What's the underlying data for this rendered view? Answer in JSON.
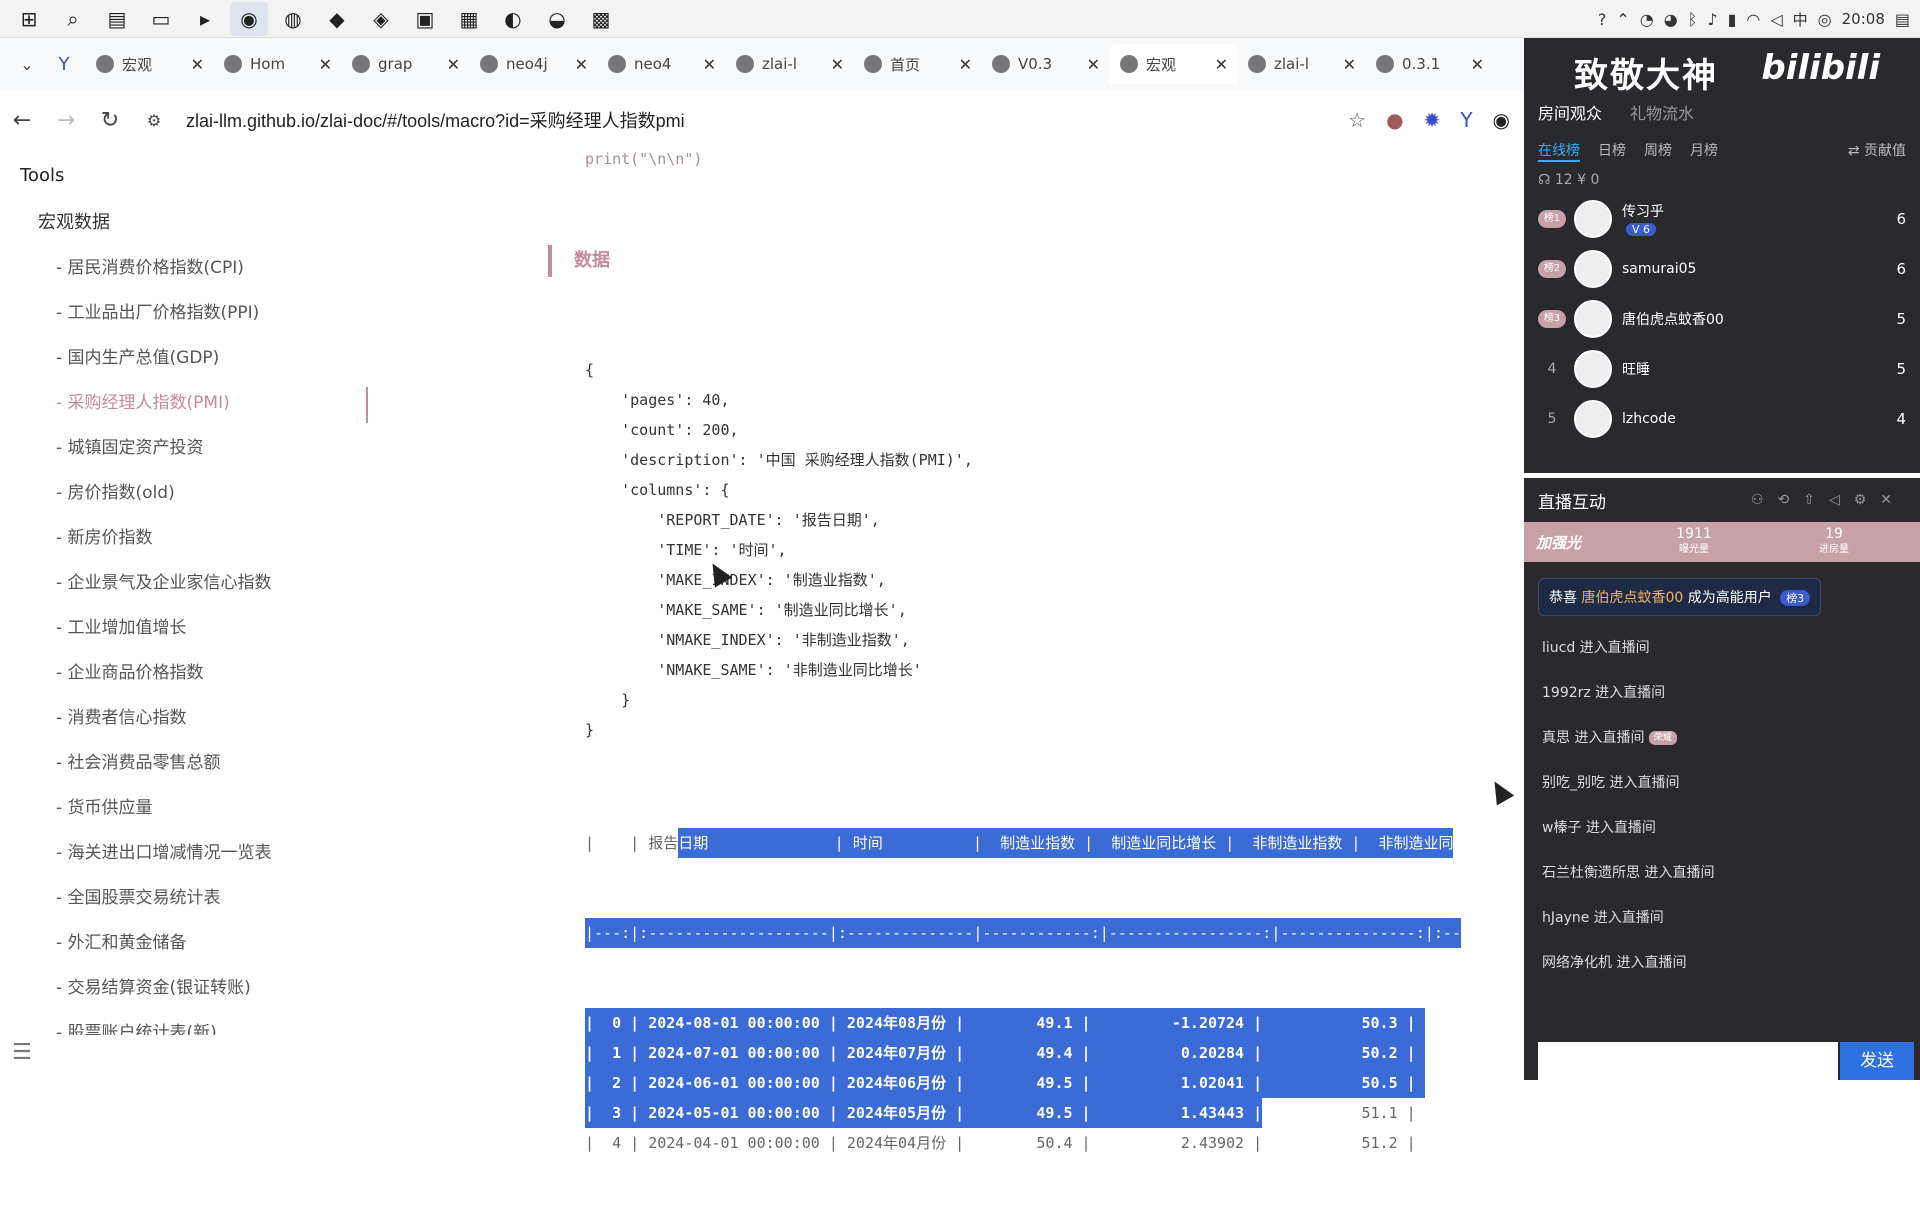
{
  "taskbar": {
    "time": "20:08",
    "ime": "中",
    "apps": [
      "start-icon",
      "search-icon",
      "taskview-icon",
      "explorer-icon",
      "terminal-icon",
      "chrome-icon",
      "wechat-icon",
      "app-icon",
      "app-icon",
      "app-icon",
      "app-icon",
      "app-icon",
      "app-icon",
      "app-icon"
    ]
  },
  "tabs": [
    {
      "title": "宏观",
      "active": false
    },
    {
      "title": "Hom",
      "active": false
    },
    {
      "title": "grap",
      "active": false
    },
    {
      "title": "neo4j",
      "active": false
    },
    {
      "title": "neo4",
      "active": false
    },
    {
      "title": "zlai-l",
      "active": false
    },
    {
      "title": "首页",
      "active": false
    },
    {
      "title": "V0.3",
      "active": false
    },
    {
      "title": "宏观",
      "active": true
    },
    {
      "title": "zlai-l",
      "active": false
    },
    {
      "title": "0.3.1",
      "active": false
    }
  ],
  "address": {
    "url": "zlai-llm.github.io/zlai-doc/#/tools/macro?id=采购经理人指数pmi"
  },
  "sidebar": {
    "title": "Tools",
    "group": "宏观数据",
    "items": [
      "- 居民消费价格指数(CPI)",
      "- 工业品出厂价格指数(PPI)",
      "- 国内生产总值(GDP)",
      "- 采购经理人指数(PMI)",
      "- 城镇固定资产投资",
      "- 房价指数(old)",
      "- 新房价指数",
      "- 企业景气及企业家信心指数",
      "- 工业增加值增长",
      "- 企业商品价格指数",
      "- 消费者信心指数",
      "- 社会消费品零售总额",
      "- 货币供应量",
      "- 海关进出口增减情况一览表",
      "- 全国股票交易统计表",
      "- 外汇和黄金储备",
      "- 交易结算资金(银证转账)",
      "- 股票账户统计表(新)"
    ],
    "active_index": 3
  },
  "content": {
    "code_top": "print(\"\\n\\n\")",
    "section": "数据",
    "json_lines": [
      "{",
      "    'pages': 40,",
      "    'count': 200,",
      "    'description': '中国 采购经理人指数(PMI)',",
      "    'columns': {",
      "        'REPORT_DATE': '报告日期',",
      "        'TIME': '时间',",
      "        'MAKE_INDEX': '制造业指数',",
      "        'MAKE_SAME': '制造业同比增长',",
      "        'NMAKE_INDEX': '非制造业指数',",
      "        'NMAKE_SAME': '非制造业同比增长'",
      "    }",
      "}"
    ],
    "table": {
      "header_pre": "|    | 报告",
      "header_hl": "日期              | 时间          |  制造业指数 |  制造业同比增长 |  非制造业指数 |  非制造业同",
      "sep": "|---:|:--------------------|:--------------|------------:|-----------------:|---------------:|:--",
      "rows": [
        {
          "hl": "|  0 | 2024-08-01 00:00:00 | 2024年08月份 |        49.1 |         -1.20724 |           50.3 | ",
          "plain": ""
        },
        {
          "hl": "|  1 | 2024-07-01 00:00:00 | 2024年07月份 |        49.4 |          0.20284 |           50.2 | ",
          "plain": ""
        },
        {
          "hl": "|  2 | 2024-06-01 00:00:00 | 2024年06月份 |        49.5 |          1.02041 |           50.5 | ",
          "plain": ""
        },
        {
          "hl": "|  3 | 2024-05-01 00:00:00 | 2024年05月份 |        49.5 |          1.43443 |",
          "plain": "           51.1 |"
        },
        {
          "hl": "",
          "plain": "|  4 | 2024-04-01 00:00:00 | 2024年04月份 |        50.4 |          2.43902 |           51.2 |"
        }
      ]
    }
  },
  "bili_top": {
    "banner": "致敬大神",
    "brand": "bilibili",
    "tabs1": [
      "房间观众",
      "礼物流水"
    ],
    "tabs2": [
      "在线榜",
      "日榜",
      "周榜",
      "月榜"
    ],
    "contrib": "⇄ 贡献值",
    "stats": "☊ 12  ¥ 0",
    "ranks": [
      {
        "badge": "榜1",
        "name": "传习乎",
        "fan": "6",
        "score": "6"
      },
      {
        "badge": "榜2",
        "name": "samurai05",
        "fan": "",
        "score": "6"
      },
      {
        "badge": "榜3",
        "name": "唐伯虎点蚊香00",
        "fan": "",
        "score": "5"
      },
      {
        "badge": "4",
        "name": "旺睡",
        "fan": "",
        "score": "5"
      },
      {
        "badge": "5",
        "name": "lzhcode",
        "fan": "",
        "score": "4"
      }
    ]
  },
  "bili_bottom": {
    "title": "直播互动",
    "strip_label": "加强光",
    "stat1_value": "1911",
    "stat1_label": "曝光量",
    "stat2_value": "19",
    "stat2_label": "进房量",
    "congrats_prefix": "恭喜 ",
    "congrats_name": "唐伯虎点蚊香00",
    "congrats_suffix": " 成为高能用户",
    "congrats_tag": "榜3",
    "messages": [
      {
        "text": "liucd 进入直播间",
        "tag": ""
      },
      {
        "text": "1992rz 进入直播间",
        "tag": ""
      },
      {
        "text": "真思 进入直播间",
        "tag": "荣耀"
      },
      {
        "text": "别吃_别吃 进入直播间",
        "tag": ""
      },
      {
        "text": "w榛子 进入直播间",
        "tag": ""
      },
      {
        "text": "石兰杜衡遗所思 进入直播间",
        "tag": ""
      },
      {
        "text": "hJayne 进入直播间",
        "tag": ""
      },
      {
        "text": "网络净化机 进入直播间",
        "tag": ""
      }
    ],
    "send": "发送"
  }
}
